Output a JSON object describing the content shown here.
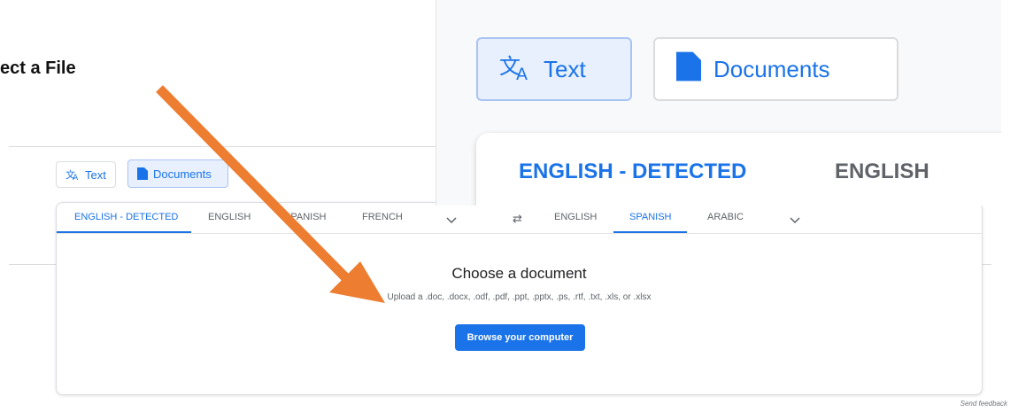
{
  "caption": "ect a File",
  "modes": {
    "text": "Text",
    "documents": "Documents"
  },
  "source_langs": [
    "ENGLISH - DETECTED",
    "ENGLISH",
    "SPANISH",
    "FRENCH"
  ],
  "target_langs": [
    "ENGLISH",
    "SPANISH",
    "ARABIC"
  ],
  "upload": {
    "title": "Choose a document",
    "hint": "Upload a .doc, .docx, .odf, .pdf, .ppt, .pptx, .ps, .rtf, .txt, .xls, or .xlsx",
    "browse_label": "Browse your computer"
  },
  "feedback": "Send feedback",
  "zoom": {
    "text": "Text",
    "documents": "Documents",
    "lang_detected": "ENGLISH - DETECTED",
    "lang_english": "ENGLISH"
  },
  "colors": {
    "accent": "#1a73e8",
    "arrow": "#ed7d31"
  }
}
